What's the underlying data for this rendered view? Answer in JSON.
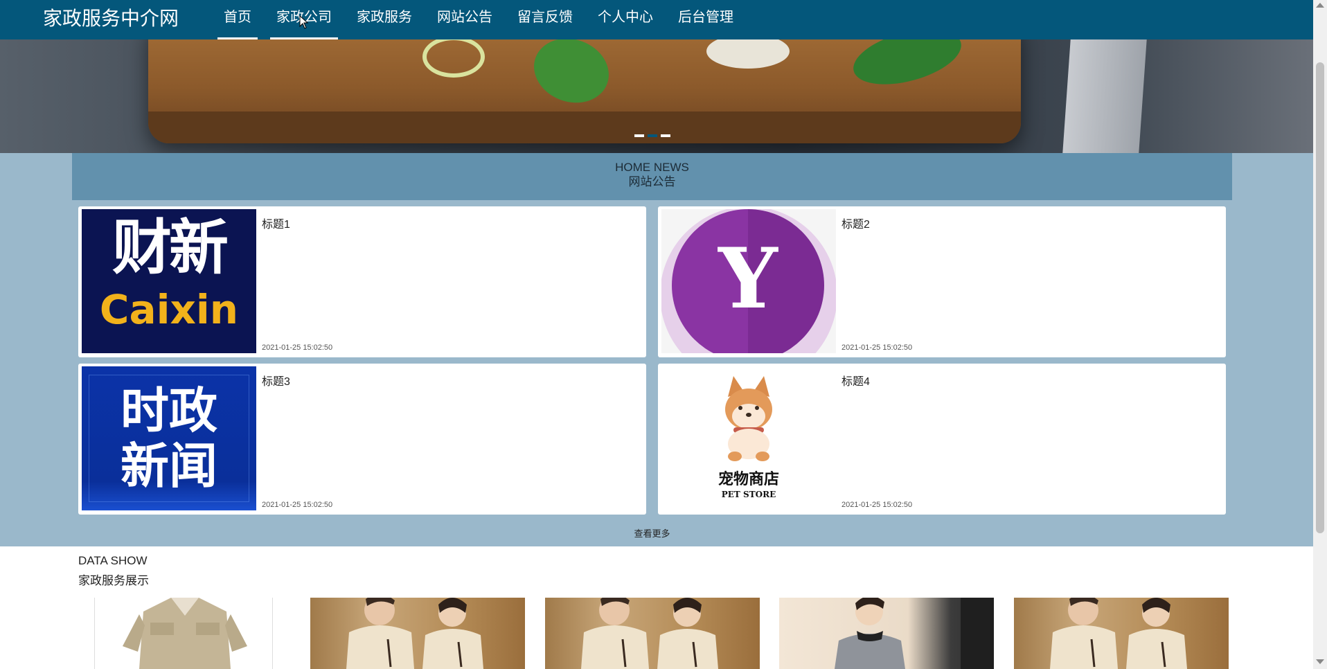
{
  "brand": "家政服务中介网",
  "nav": {
    "items": [
      {
        "label": "首页"
      },
      {
        "label": "家政公司"
      },
      {
        "label": "家政服务"
      },
      {
        "label": "网站公告"
      },
      {
        "label": "留言反馈"
      },
      {
        "label": "个人中心"
      },
      {
        "label": "后台管理"
      }
    ],
    "active_index": 0
  },
  "news": {
    "title_en": "HOME NEWS",
    "title_cn": "网站公告",
    "items": [
      {
        "title": "标题1",
        "time": "2021-01-25 15:02:50",
        "logo_line1": "财新",
        "logo_line2": "Caixin"
      },
      {
        "title": "标题2",
        "time": "2021-01-25 15:02:50",
        "logo_letter": "Y"
      },
      {
        "title": "标题3",
        "time": "2021-01-25 15:02:50",
        "logo_line1": "时政",
        "logo_line2": "新闻"
      },
      {
        "title": "标题4",
        "time": "2021-01-25 15:02:50",
        "logo_line1": "宠物商店",
        "logo_line2": "PET STORE"
      }
    ],
    "more": "查看更多"
  },
  "data_show": {
    "title_en": "DATA SHOW",
    "title_cn": "家政服务展示"
  },
  "colors": {
    "navbar": "#04577b",
    "news_band": "#9ab8cb",
    "news_header": "#6291ad",
    "caixin_bg": "#0b1452",
    "caixin_accent": "#f2b21b",
    "yahoo_purple": "#7b2b93",
    "shizheng_bg": "#0b33a8"
  }
}
